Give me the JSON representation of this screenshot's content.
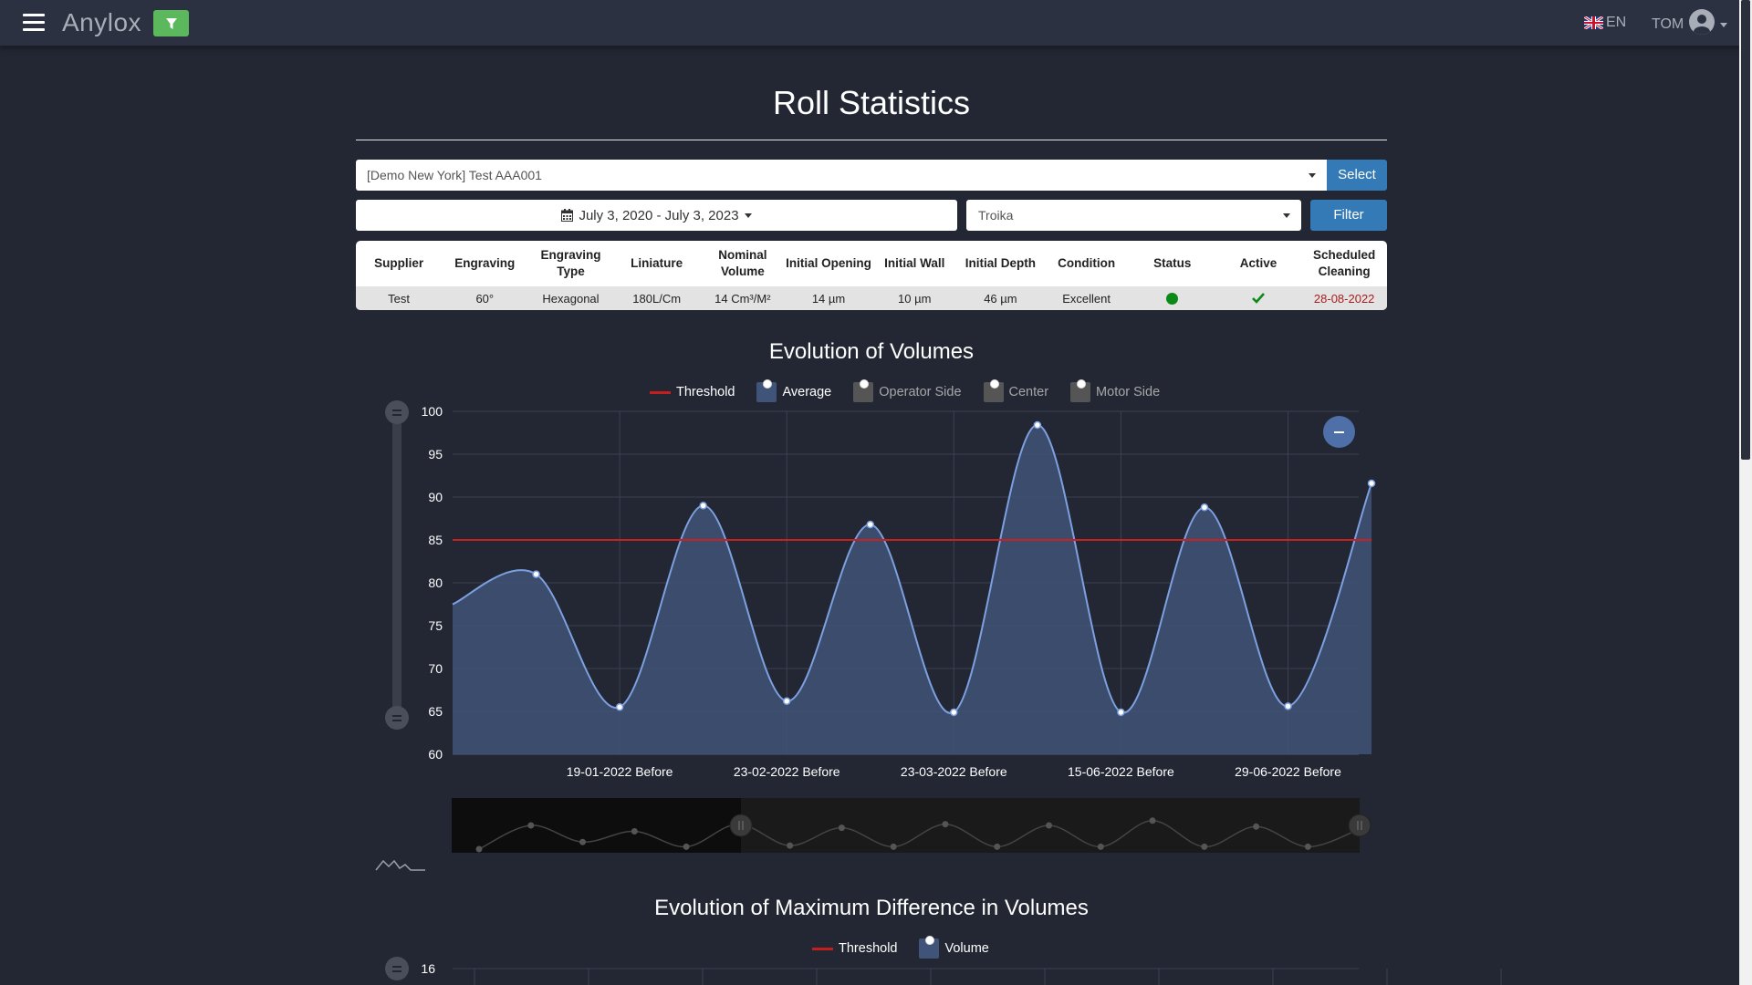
{
  "header": {
    "brand": "Anylox",
    "language": "EN",
    "user": "TOM"
  },
  "page": {
    "title": "Roll Statistics"
  },
  "filters": {
    "roll_select_value": "[Demo New York] Test AAA001",
    "select_button": "Select",
    "date_range": "July 3, 2020 - July 3, 2023",
    "analyzer_value": "Troika",
    "filter_button": "Filter"
  },
  "roll_table": {
    "headers": [
      "Supplier",
      "Engraving",
      "Engraving Type",
      "Liniature",
      "Nominal Volume",
      "Initial Opening",
      "Initial Wall",
      "Initial Depth",
      "Condition",
      "Status",
      "Active",
      "Scheduled Cleaning"
    ],
    "row": {
      "supplier": "Test",
      "engraving": "60°",
      "engraving_type": "Hexagonal",
      "liniature": "180L/Cm",
      "nominal_volume": "14 Cm³/M²",
      "initial_opening": "14 µm",
      "initial_wall": "10 µm",
      "initial_depth": "46 µm",
      "condition": "Excellent",
      "status_color": "#0b8a17",
      "active_icon": "check-icon",
      "scheduled_cleaning": "28-08-2022",
      "scheduled_cleaning_color": "#a61e1e"
    }
  },
  "chart_data": [
    {
      "type": "area",
      "title": "Evolution of Volumes",
      "legend": [
        {
          "name": "Threshold",
          "style": "line",
          "color": "#cc1f1f",
          "active": true
        },
        {
          "name": "Average",
          "style": "area",
          "color": "#3f5478",
          "active": true
        },
        {
          "name": "Operator Side",
          "style": "area",
          "color": "#555555",
          "active": false
        },
        {
          "name": "Center",
          "style": "area",
          "color": "#555555",
          "active": false
        },
        {
          "name": "Motor Side",
          "style": "area",
          "color": "#555555",
          "active": false
        }
      ],
      "legend_placement": "top-center",
      "ylim": [
        60,
        100
      ],
      "yticks": [
        60,
        65,
        70,
        75,
        80,
        85,
        90,
        95,
        100
      ],
      "x_tick_labels": [
        "19-01-2022 Before",
        "23-02-2022 Before",
        "23-03-2022 Before",
        "15-06-2022 Before",
        "29-06-2022 Before"
      ],
      "threshold": 85,
      "series": [
        {
          "name": "Average",
          "values": [
            77.5,
            81.0,
            65.5,
            89.0,
            66.2,
            86.8,
            64.9,
            98.4,
            64.9,
            88.8,
            65.6,
            91.6
          ]
        }
      ],
      "grid": true,
      "navigator": true
    },
    {
      "type": "area",
      "title": "Evolution of Maximum Difference in Volumes",
      "legend": [
        {
          "name": "Threshold",
          "style": "line",
          "color": "#cc1f1f",
          "active": true
        },
        {
          "name": "Volume",
          "style": "area",
          "color": "#3f5478",
          "active": true
        }
      ],
      "yticks_visible": [
        16
      ]
    }
  ]
}
